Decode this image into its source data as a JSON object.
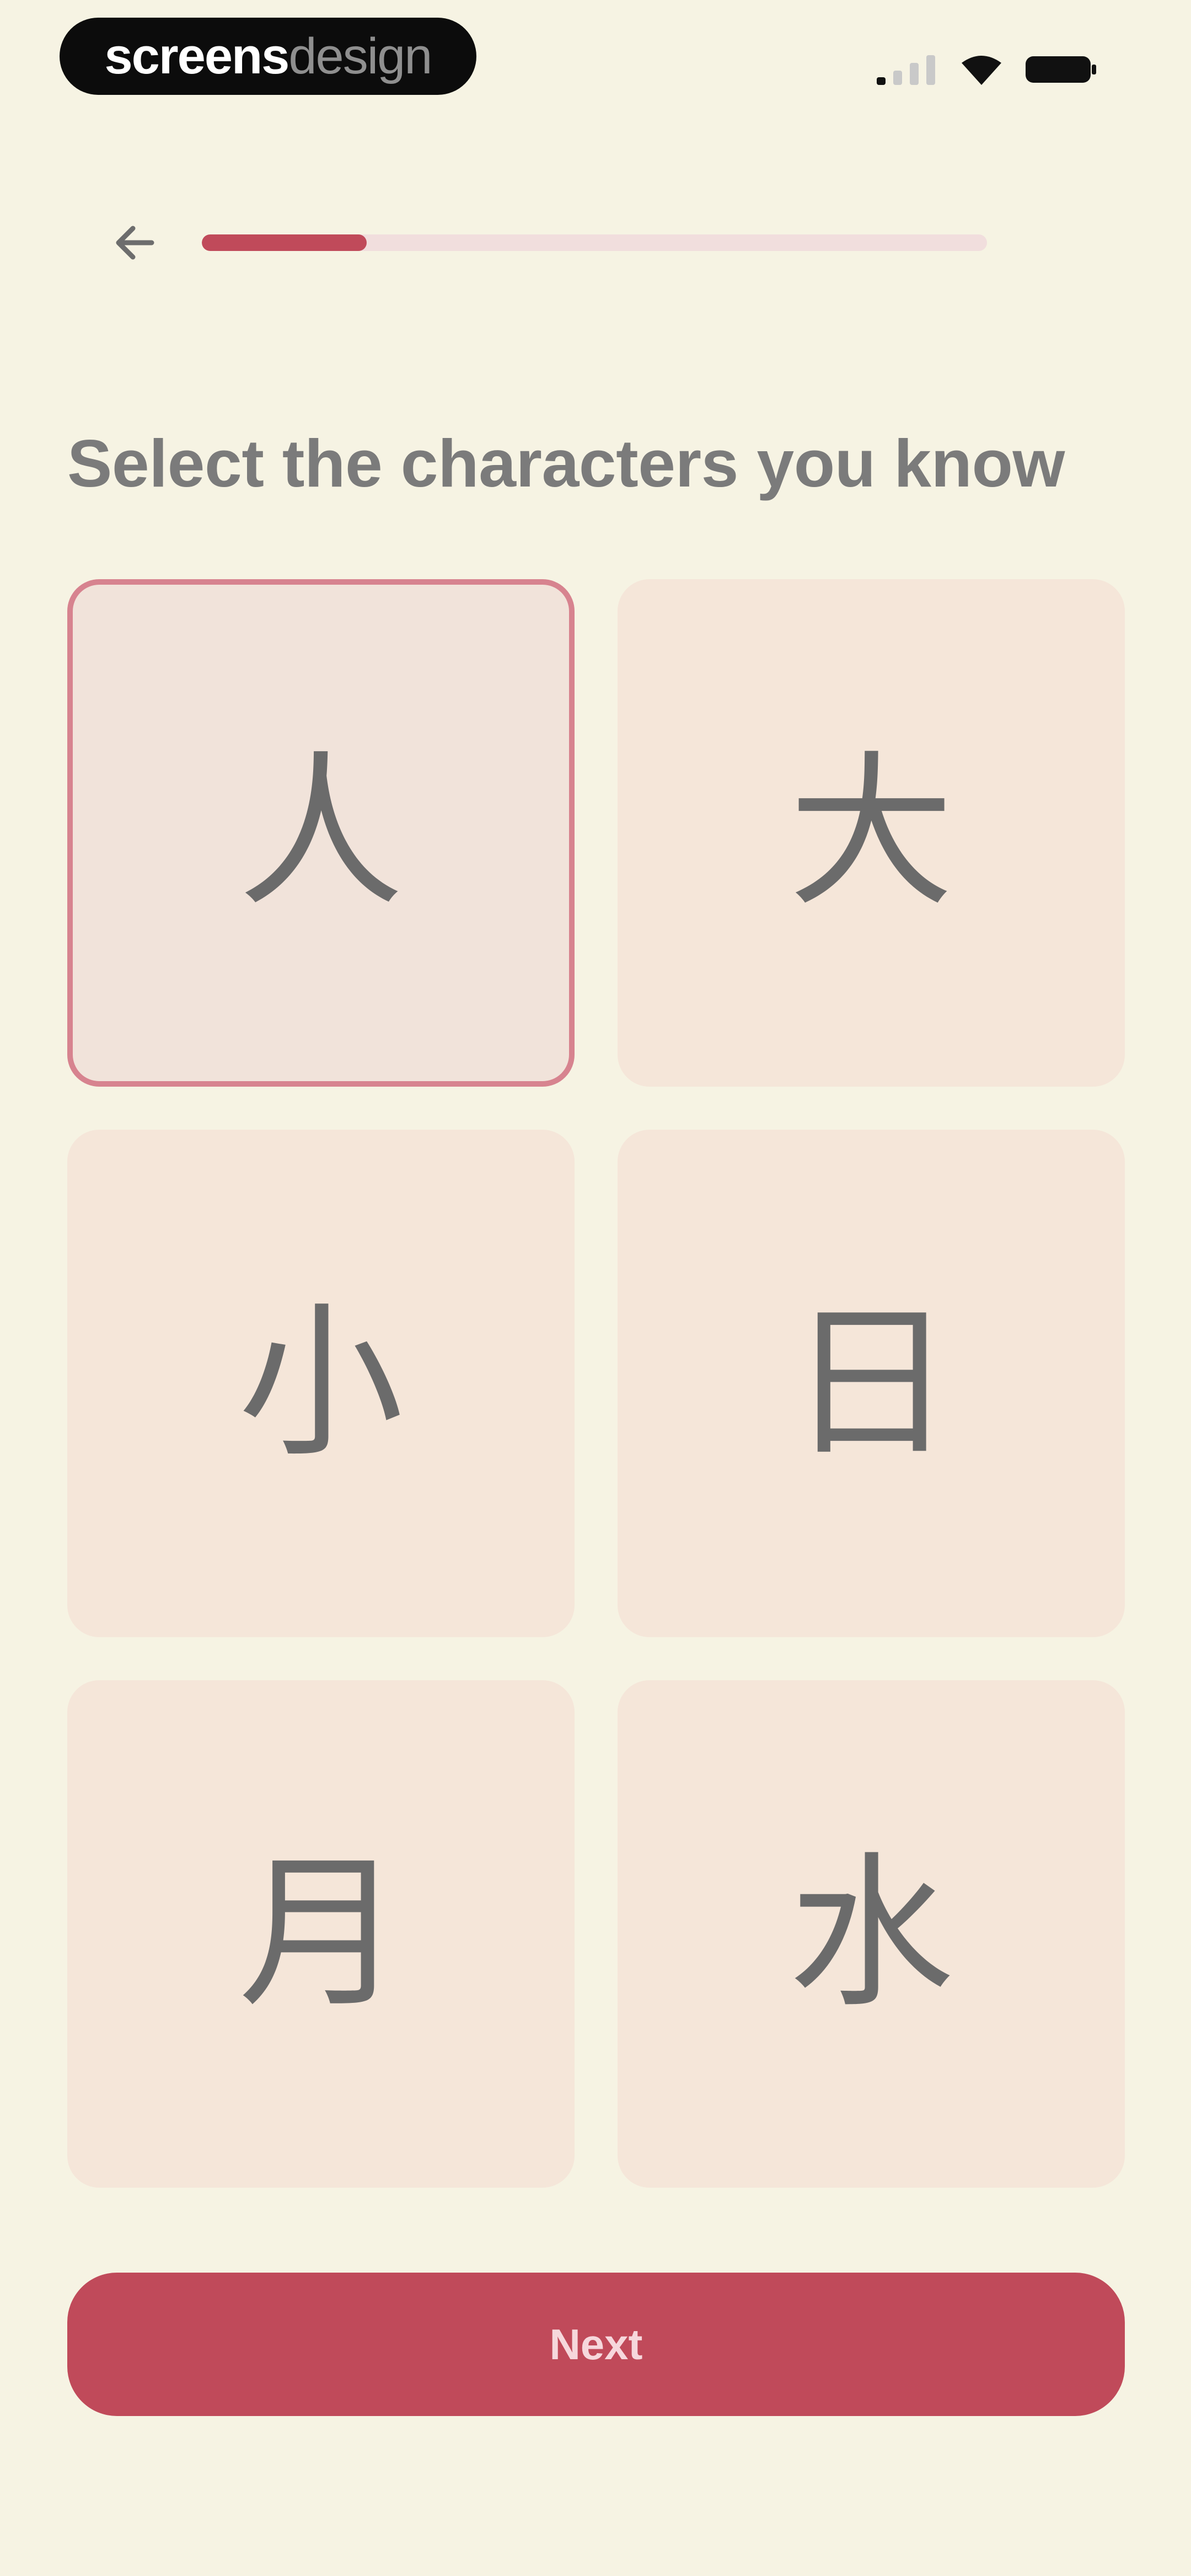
{
  "status_bar": {
    "brand_bold": "screens",
    "brand_light": "design",
    "icons": [
      "signal-icon",
      "wifi-icon",
      "battery-icon"
    ]
  },
  "nav": {
    "back_icon": "arrow-left-icon",
    "progress": 0.21
  },
  "question": {
    "title": "Select the characters you know"
  },
  "cards": [
    {
      "char": "人",
      "selected": true
    },
    {
      "char": "大",
      "selected": false
    },
    {
      "char": "小",
      "selected": false
    },
    {
      "char": "日",
      "selected": false
    },
    {
      "char": "月",
      "selected": false
    },
    {
      "char": "水",
      "selected": false
    }
  ],
  "footer": {
    "next_label": "Next"
  },
  "colors": {
    "background": "#f6f3e3",
    "accent": "#c04a5a",
    "card": "#f5e6d9",
    "selected_border": "#d7838f",
    "glyph": "#6b6b6b"
  }
}
